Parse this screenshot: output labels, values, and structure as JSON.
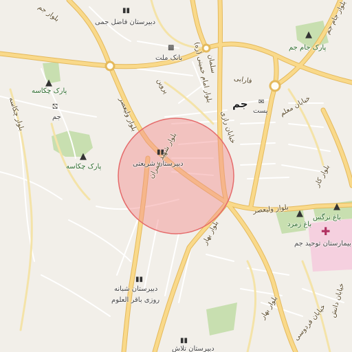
{
  "map": {
    "city": "جم",
    "poi": {
      "school_fazel": "دبیرستان فاضل جمی",
      "bank_mellat": "بانک ملت",
      "park_jam": "پارک جام جم",
      "park_chakaseh_1": "پارک چکاسه",
      "jam_small": "جم",
      "park_chakaseh_2": "پارک چکاسه",
      "school_shariati": "دبیرستان شریعتی",
      "post": "پست",
      "bagh_narges": "باغ نرگس",
      "bagh_zomorod": "باغ زمرد",
      "hospital": "بیمارستان توحید جم",
      "school_shabaneh": "دبیرستان شبانه",
      "school_bagher": "روزی باقر العلوم",
      "school_bottom": "دبیرستان تلاش"
    },
    "roads": {
      "blvd_velayat": "بلوار امام خمینی (ره)",
      "blvd_valiasr_1": "بلوار ولیعصر",
      "blvd_valiasr_2": "بلوار ولیعصر",
      "blvd_shahid": "بلوار شهید عمران",
      "blvd_bahar_1": "بلوار بهار",
      "blvd_bahar_2": "بلوار بهار",
      "khayaban_razi": "خیابان رازی",
      "khayaban_moallem": "خیابان معلم",
      "khayaban_farabi": "فارابی",
      "blvd_kar": "بلوار کار",
      "blvd_jam": "بلوار جام جم",
      "blvd_chakaseh": "بلوار چکاسه",
      "blvd_left": "بلوار جم",
      "khayaban_ferdowsi": "خیابان فردوسی",
      "khayaban_ostad": "خیابان دانش",
      "parvin": "پروین",
      "sarkar": "سلمان"
    },
    "colors": {
      "road_major": "#f9d98a",
      "road_casing": "#e4b95c",
      "road_minor": "#ffffff",
      "park": "#c8dfb0",
      "hospital": "#f5d0df",
      "circle": "#f28b8b"
    }
  }
}
